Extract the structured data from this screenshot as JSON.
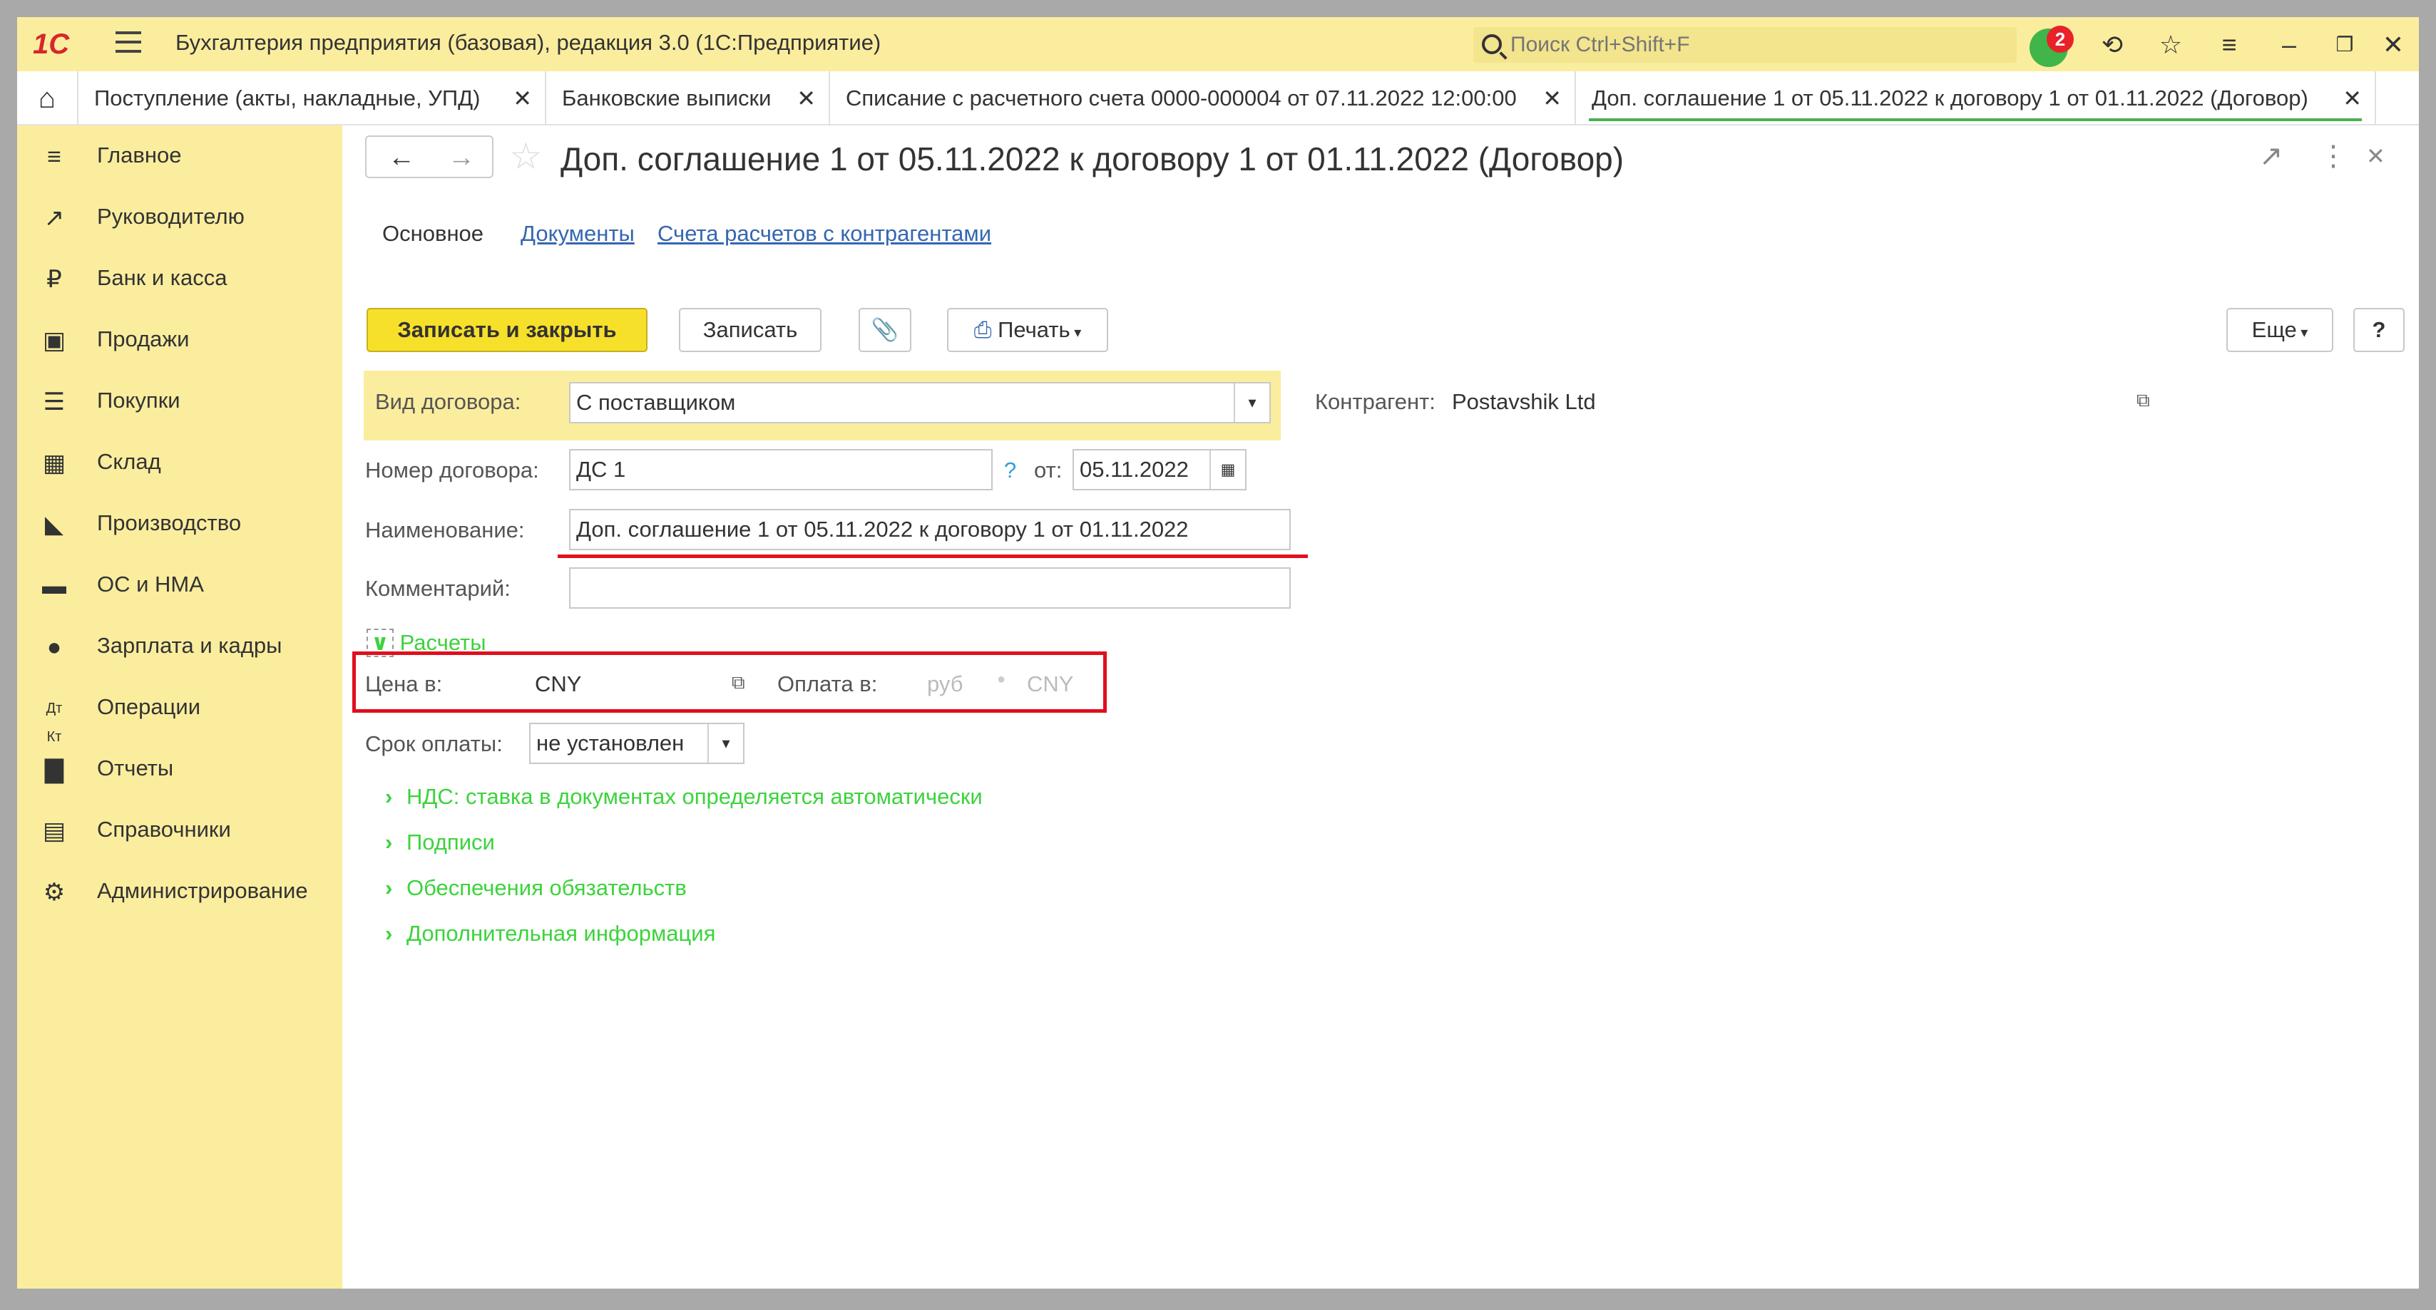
{
  "titlebar": {
    "logo": "1С",
    "app_title": "Бухгалтерия предприятия (базовая), редакция 3.0  (1С:Предприятие)",
    "search_placeholder": "Поиск Ctrl+Shift+F",
    "notifications_count": "2"
  },
  "tabs": [
    {
      "label": "Поступление (акты, накладные, УПД)"
    },
    {
      "label": "Банковские выписки"
    },
    {
      "label": "Списание с расчетного счета 0000-000004 от 07.11.2022 12:00:00"
    },
    {
      "label": "Доп. соглашение 1 от 05.11.2022 к договору 1 от 01.11.2022 (Договор)"
    }
  ],
  "sidebar": {
    "items": [
      {
        "label": "Главное"
      },
      {
        "label": "Руководителю"
      },
      {
        "label": "Банк и касса"
      },
      {
        "label": "Продажи"
      },
      {
        "label": "Покупки"
      },
      {
        "label": "Склад"
      },
      {
        "label": "Производство"
      },
      {
        "label": "ОС и НМА"
      },
      {
        "label": "Зарплата и кадры"
      },
      {
        "label": "Операции"
      },
      {
        "label": "Отчеты"
      },
      {
        "label": "Справочники"
      },
      {
        "label": "Администрирование"
      }
    ]
  },
  "document": {
    "title": "Доп. соглашение 1 от 05.11.2022 к договору 1 от 01.11.2022 (Договор)",
    "form_tabs": [
      "Основное",
      "Документы",
      "Счета расчетов с контрагентами"
    ]
  },
  "toolbar": {
    "save_close": "Записать и закрыть",
    "save": "Записать",
    "print": "Печать",
    "more": "Еще",
    "help": "?"
  },
  "form": {
    "contract_type_label": "Вид договора:",
    "contract_type_value": "С поставщиком",
    "counterparty_label": "Контрагент:",
    "counterparty_value": "Postavshik Ltd",
    "number_label": "Номер договора:",
    "number_value": "ДС 1",
    "number_help": "?",
    "date_label": "от:",
    "date_value": "05.11.2022",
    "name_label": "Наименование:",
    "name_value": "Доп. соглашение 1 от 05.11.2022 к договору 1 от 01.11.2022",
    "comment_label": "Комментарий:",
    "comment_value": "",
    "settlements_section": "Расчеты",
    "price_in_label": "Цена в:",
    "price_in_value": "CNY",
    "payment_in_label": "Оплата в:",
    "payment_option_rub": "руб",
    "payment_option_cny": "CNY",
    "payment_term_label": "Срок оплаты:",
    "payment_term_value": "не установлен",
    "sections": [
      "НДС: ставка в документах определяется автоматически",
      "Подписи",
      "Обеспечения обязательств",
      "Дополнительная информация"
    ]
  },
  "colors": {
    "titlebar_bg": "#fbed9e",
    "sidebar_bg": "#fbed9e",
    "primary_button": "#f7e02a",
    "highlight_red": "#e0101e",
    "section_green": "#3cd33c",
    "link_blue": "#3566b0"
  }
}
